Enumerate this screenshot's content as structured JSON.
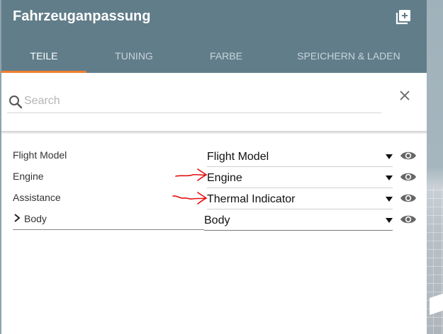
{
  "header": {
    "title": "Fahrzeuganpassung",
    "add_icon": "library-add-icon",
    "accent_color": "#617d8a",
    "indicator_color": "#f07f2c"
  },
  "tabs": [
    {
      "label": "TEILE",
      "active": true
    },
    {
      "label": "TUNING",
      "active": false
    },
    {
      "label": "FARBE",
      "active": false
    },
    {
      "label": "SPEICHERN & LADEN",
      "active": false
    }
  ],
  "search": {
    "placeholder": "Search",
    "value": "",
    "icon": "search-icon",
    "clear_icon": "close-icon"
  },
  "parts": [
    {
      "label": "Flight Model",
      "selected": "Flight Model",
      "expandable": false,
      "visible": true
    },
    {
      "label": "Engine",
      "selected": "Engine",
      "expandable": false,
      "visible": true,
      "annotated": true
    },
    {
      "label": "Assistance",
      "selected": "Thermal Indicator",
      "expandable": false,
      "visible": true,
      "annotated": true
    },
    {
      "label": "Body",
      "selected": "Body",
      "expandable": true,
      "visible": true
    }
  ],
  "annotation_color": "#e01010"
}
